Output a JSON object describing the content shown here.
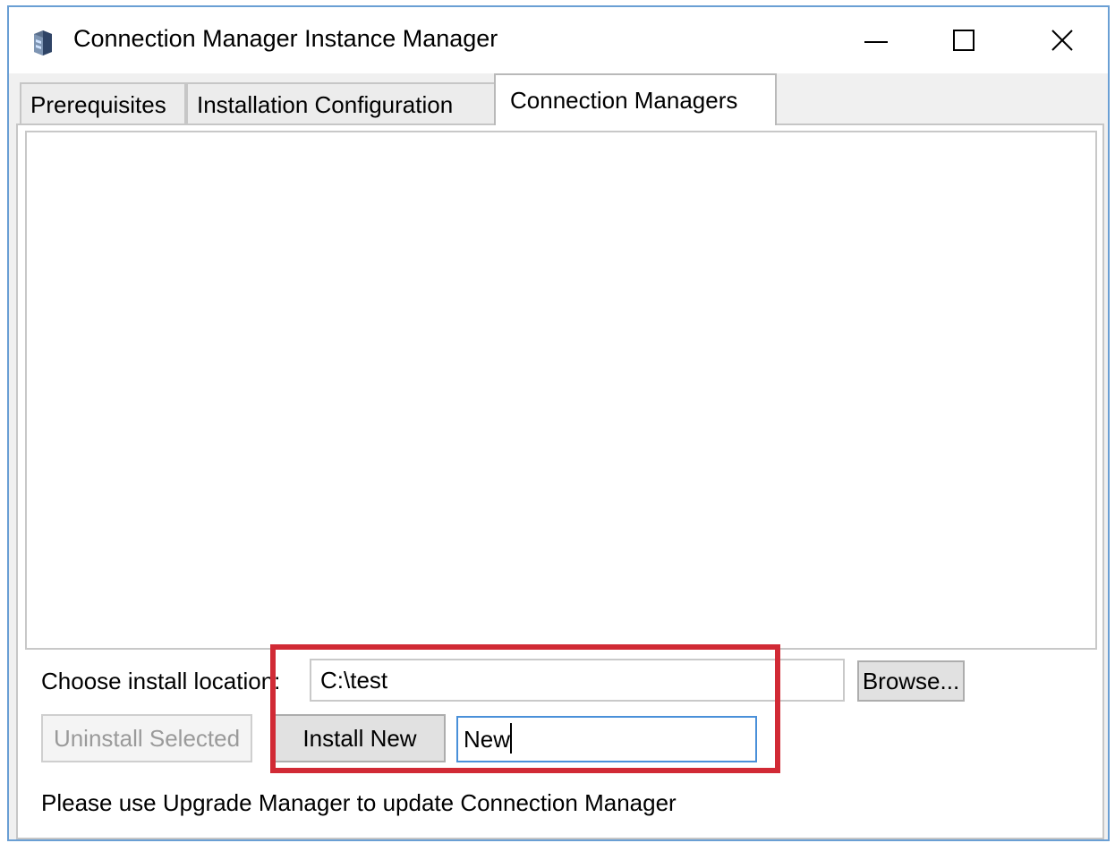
{
  "window": {
    "title": "Connection Manager Instance Manager",
    "icon": "server-app-icon",
    "controls": {
      "minimize_icon": "minimize-icon",
      "maximize_icon": "maximize-icon",
      "close_icon": "close-icon"
    }
  },
  "tabs": [
    {
      "label": "Prerequisites",
      "active": false
    },
    {
      "label": "Installation Configuration",
      "active": false
    },
    {
      "label": "Connection Managers",
      "active": true
    }
  ],
  "connection_managers": {
    "install_location_label": "Choose install location:",
    "install_location_value": "C:\\test",
    "browse_label": "Browse...",
    "uninstall_label": "Uninstall Selected",
    "uninstall_enabled": false,
    "install_new_label": "Install New",
    "instance_name_value": "New",
    "info_text": "Please use Upgrade Manager to update Connection Manager"
  },
  "colors": {
    "highlight": "#d12a35",
    "focus_border": "#4a90d9",
    "window_border": "#6a9fd4"
  }
}
